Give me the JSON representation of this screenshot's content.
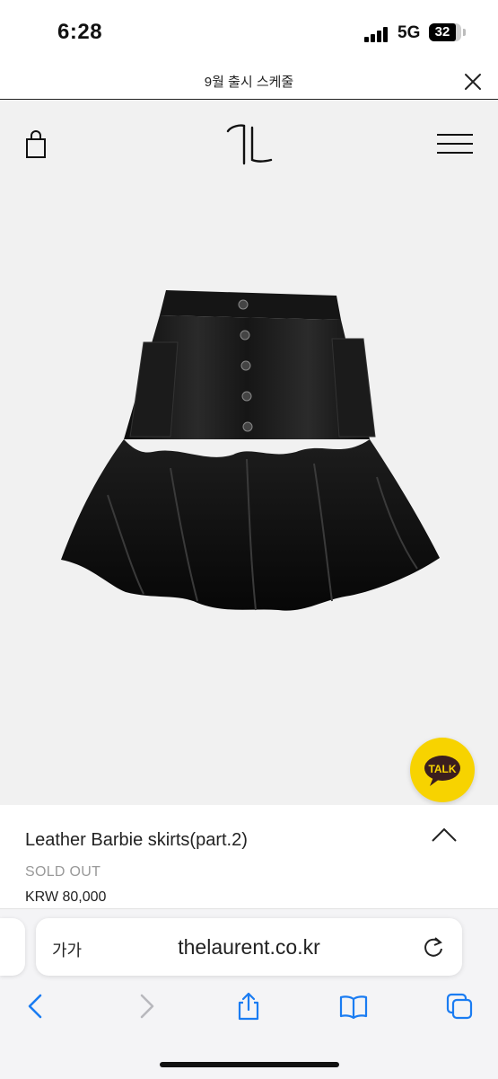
{
  "status_bar": {
    "time": "6:28",
    "network": "5G",
    "battery": "32"
  },
  "banner": {
    "text": "9월 출시 스케줄"
  },
  "header": {
    "logo_name": "laurent-logo"
  },
  "product": {
    "name": "Leather Barbie skirts(part.2)",
    "status": "SOLD OUT",
    "price": "KRW 80,000"
  },
  "talk_button": {
    "label": "TALK"
  },
  "browser": {
    "text_size_label": "가가",
    "url": "thelaurent.co.kr"
  },
  "colors": {
    "talk_yellow": "#f7d300",
    "ios_blue": "#1a7cf2",
    "disabled_gray": "#b8b8bd"
  }
}
